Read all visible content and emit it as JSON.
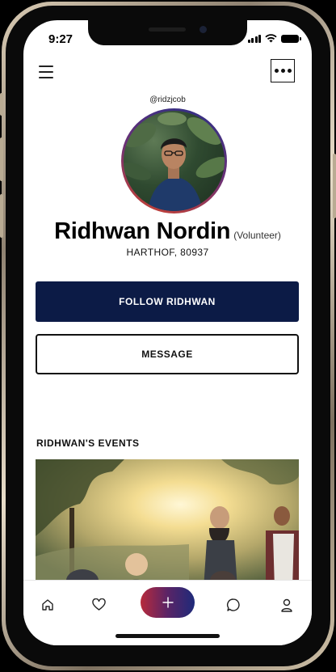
{
  "status_bar": {
    "time": "9:27"
  },
  "profile": {
    "handle": "@ridzjcob",
    "name": "Ridhwan Nordin",
    "role": "(Volunteer)",
    "location": "HARTHOF, 80937"
  },
  "actions": {
    "follow_label": "FOLLOW RIDHWAN",
    "message_label": "MESSAGE"
  },
  "events": {
    "title": "RIDHWAN'S EVENTS"
  },
  "nav": {
    "items": [
      "home-icon",
      "heart-icon",
      "plus-icon",
      "chat-icon",
      "user-icon"
    ]
  },
  "colors": {
    "primary": "#0c1b46",
    "fab_gradient": [
      "#b72a3c",
      "#1e2a7a"
    ]
  }
}
